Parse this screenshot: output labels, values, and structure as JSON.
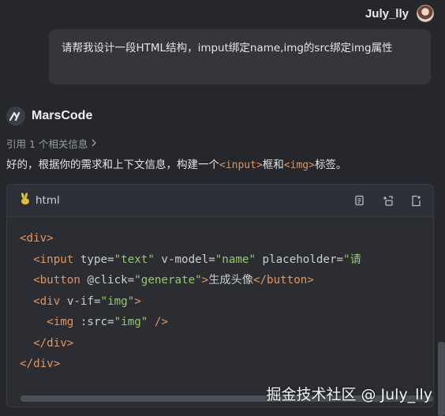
{
  "user": {
    "name": "July_lly"
  },
  "user_message": "请帮我设计一段HTML结构，imput绑定name,img的src绑定img属性",
  "bot": {
    "name": "MarsCode",
    "reference_text": "引用 1 个相关信息",
    "intro_before": "好的，根据你的需求和上下文信息，构建一个",
    "intro_tag1": "<input>",
    "intro_mid": "框和",
    "intro_tag2": "<img>",
    "intro_after": "标签。"
  },
  "code_block": {
    "language": "html",
    "lines": [
      "<div>",
      "  <input type=\"text\" v-model=\"name\" placeholder=\"请",
      "  <button @click=\"generate\">生成头像</button>",
      "  <div v-if=\"img\">",
      "    <img :src=\"img\" />",
      "  </div>",
      "</div>"
    ],
    "tools": [
      "copy-icon",
      "insert-icon",
      "new-file-icon"
    ]
  },
  "watermark": "掘金技术社区 @ July_lly",
  "colors": {
    "background": "#25272c",
    "tag": "#e0955f",
    "string": "#97c771",
    "bubble": "#34363c"
  }
}
